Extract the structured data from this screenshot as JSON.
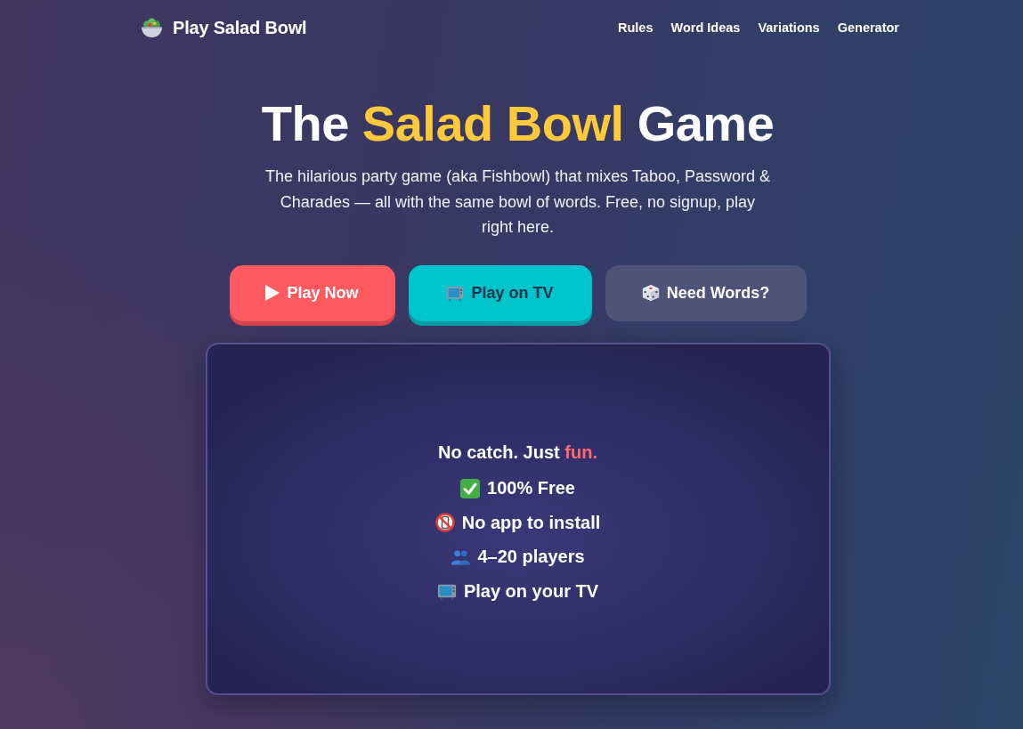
{
  "nav": {
    "brand": "Play Salad Bowl",
    "links": [
      "Rules",
      "Word Ideas",
      "Variations",
      "Generator"
    ]
  },
  "hero": {
    "title": [
      {
        "text": "The ",
        "highlight": false
      },
      {
        "text": "Salad Bowl",
        "highlight": true
      },
      {
        "text": " Game",
        "highlight": false
      }
    ],
    "subtitle": "The hilarious party game (aka Fishbowl) that mixes Taboo, Password & Charades — all with the same bowl of words. Free, no signup, play right here.",
    "buttons": [
      {
        "kind": "play",
        "label": "Play Now"
      },
      {
        "kind": "tv",
        "label": "Play on TV"
      },
      {
        "kind": "dice",
        "label": "Need Words?"
      }
    ]
  },
  "card": {
    "heading": [
      {
        "text": "No catch. Just ",
        "highlight": false
      },
      {
        "text": "fun.",
        "highlight": true
      }
    ],
    "features": [
      {
        "kind": "check",
        "text": "100% Free"
      },
      {
        "kind": "no-phone",
        "text": "No app to install"
      },
      {
        "kind": "people",
        "text": "4–20 players"
      },
      {
        "kind": "tv",
        "text": "Play on your TV"
      }
    ]
  }
}
